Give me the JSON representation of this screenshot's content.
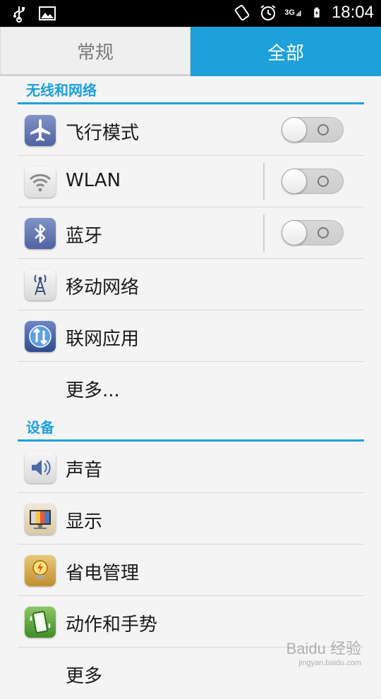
{
  "status_bar": {
    "time": "18:04",
    "network": "3G",
    "icons_left": [
      "usb-icon",
      "image-icon"
    ],
    "icons_right": [
      "rotation-icon",
      "alarm-icon",
      "signal-icon",
      "battery-charging-icon"
    ]
  },
  "tabs": [
    {
      "label": "常规",
      "active": false
    },
    {
      "label": "全部",
      "active": true
    }
  ],
  "sections": {
    "wireless": {
      "title": "无线和网络",
      "items": {
        "airplane": {
          "label": "飞行模式",
          "toggle": "off"
        },
        "wlan": {
          "label": "WLAN",
          "toggle": "off"
        },
        "bluetooth": {
          "label": "蓝牙",
          "toggle": "off"
        },
        "mobile_network": {
          "label": "移动网络"
        },
        "network_apps": {
          "label": "联网应用"
        },
        "more": {
          "label": "更多..."
        }
      }
    },
    "device": {
      "title": "设备",
      "items": {
        "sound": {
          "label": "声音"
        },
        "display": {
          "label": "显示"
        },
        "power": {
          "label": "省电管理"
        },
        "gestures": {
          "label": "动作和手势"
        },
        "more": {
          "label": "更多"
        }
      }
    }
  },
  "watermark": {
    "brand": "Baidu 经验",
    "url": "jingyan.baidu.com"
  },
  "colors": {
    "accent": "#1ea1d8",
    "background": "#f4f4f4",
    "statusbar": "#000000"
  }
}
